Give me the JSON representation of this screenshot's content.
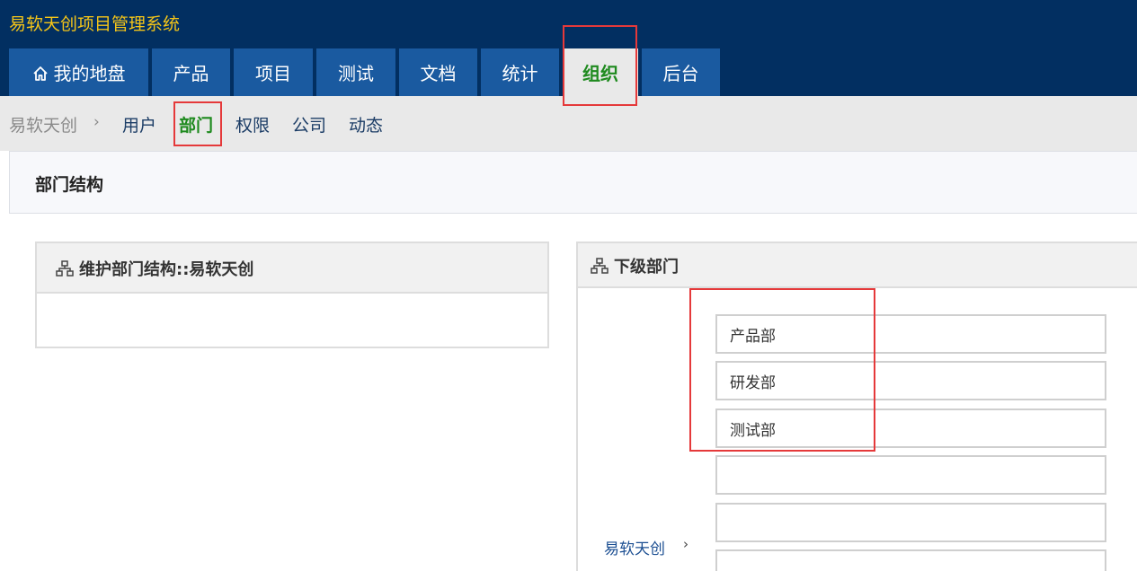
{
  "app": {
    "title": "易软天创项目管理系统"
  },
  "nav": {
    "tabs": [
      {
        "label": "我的地盘",
        "icon": "home-icon"
      },
      {
        "label": "产品"
      },
      {
        "label": "项目"
      },
      {
        "label": "测试"
      },
      {
        "label": "文档"
      },
      {
        "label": "统计"
      },
      {
        "label": "组织",
        "active": true
      },
      {
        "label": "后台"
      }
    ]
  },
  "subnav": {
    "root": "易软天创",
    "separator": "›",
    "items": [
      {
        "label": "用户"
      },
      {
        "label": "部门",
        "active": true
      },
      {
        "label": "权限"
      },
      {
        "label": "公司"
      },
      {
        "label": "动态"
      }
    ]
  },
  "page": {
    "title": "部门结构"
  },
  "tree_panel": {
    "title": "维护部门结构::易软天创",
    "icon": "org-chart-icon"
  },
  "child_panel": {
    "title": "下级部门",
    "icon": "org-chart-icon",
    "parent_label": "易软天创",
    "parent_chevron": "›",
    "departments": [
      "产品部",
      "研发部",
      "测试部",
      "",
      "",
      ""
    ]
  },
  "colors": {
    "topbar": "#022f61",
    "tab": "#1a5aa0",
    "active_text": "#1e8a1e",
    "title_text": "#f5c518",
    "highlight": "#e5393a"
  }
}
